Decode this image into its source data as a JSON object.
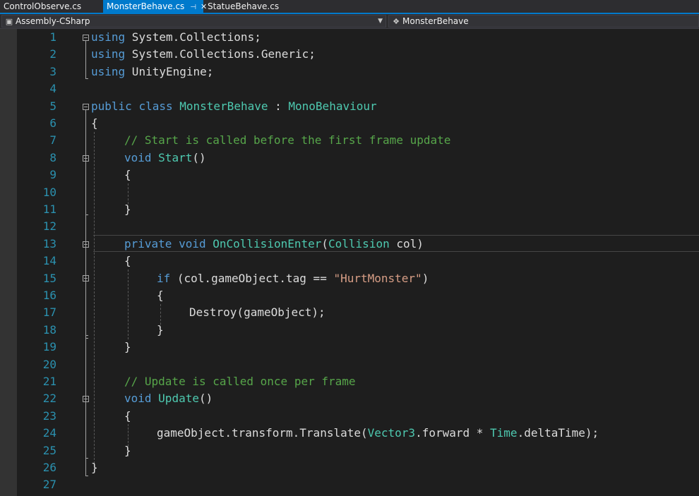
{
  "tabs": [
    {
      "label": "ControlObserve.cs",
      "active": false
    },
    {
      "label": "MonsterBehave.cs",
      "active": true
    },
    {
      "label": "StatueBehave.cs",
      "active": false
    }
  ],
  "nav": {
    "project": "Assembly-CSharp",
    "class": "MonsterBehave"
  },
  "code": {
    "line_numbers": [
      "1",
      "2",
      "3",
      "4",
      "5",
      "6",
      "7",
      "8",
      "9",
      "10",
      "11",
      "12",
      "13",
      "14",
      "15",
      "16",
      "17",
      "18",
      "19",
      "20",
      "21",
      "22",
      "23",
      "24",
      "25",
      "26",
      "27"
    ],
    "l1": {
      "kw": "using",
      "rest": " System.Collections;"
    },
    "l2": {
      "kw": "using",
      "rest": " System.Collections.Generic;"
    },
    "l3": {
      "kw": "using",
      "rest": " UnityEngine;"
    },
    "l5": {
      "kw1": "public",
      "kw2": "class",
      "name": "MonsterBehave",
      "colon": " : ",
      "base": "MonoBehaviour"
    },
    "l6": "{",
    "l7": "// Start is called before the first frame update",
    "l8": {
      "kw": "void",
      "name": "Start",
      "rest": "()"
    },
    "l9": "{",
    "l11": "}",
    "l13": {
      "kw1": "private",
      "kw2": "void",
      "name": "OnCollisionEnter",
      "p1": "(",
      "type": "Collision",
      "p2": " col)"
    },
    "l14": "{",
    "l15": {
      "kw": "if",
      "mid": " (col.gameObject.tag == ",
      "str": "\"HurtMonster\"",
      "end": ")"
    },
    "l16": "{",
    "l17": "Destroy(gameObject);",
    "l18": "}",
    "l19": "}",
    "l21": "// Update is called once per frame",
    "l22": {
      "kw": "void",
      "name": "Update",
      "rest": "()"
    },
    "l23": "{",
    "l24": {
      "a": "gameObject.transform.Translate(",
      "t1": "Vector3",
      "b": ".forward * ",
      "t2": "Time",
      "c": ".deltaTime);"
    },
    "l25": "}",
    "l26": "}"
  },
  "colors": {
    "keyword": "#569cd6",
    "type": "#4ec9b0",
    "comment": "#57a64a",
    "string": "#d69d85",
    "line_number": "#2b91af",
    "accent": "#007acc"
  }
}
